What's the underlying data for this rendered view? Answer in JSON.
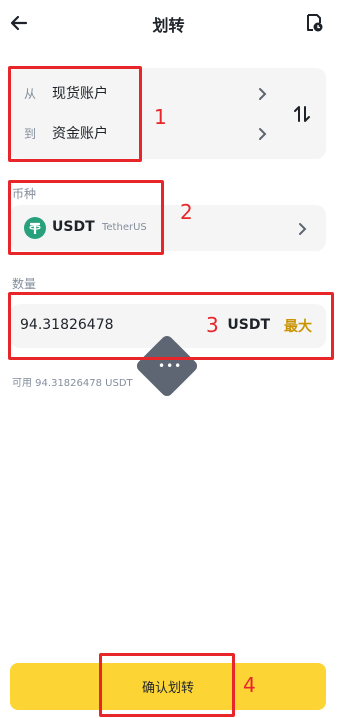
{
  "header": {
    "title": "划转",
    "back_icon": "back-arrow-icon",
    "history_icon": "history-icon"
  },
  "transfer": {
    "from_prefix": "从",
    "from_account": "现货账户",
    "to_prefix": "到",
    "to_account": "资金账户",
    "swap_icon": "swap-vertical-icon"
  },
  "coin": {
    "label": "币种",
    "symbol": "USDT",
    "name": "TetherUS",
    "logo_color": "#26a17b"
  },
  "amount": {
    "label": "数量",
    "value": "94.31826478",
    "unit": "USDT",
    "max_label": "最大",
    "available": "可用 94.31826478 USDT"
  },
  "floating": {
    "dots": "•••"
  },
  "confirm_label": "确认划转",
  "annotations": {
    "n1": "1",
    "n2": "2",
    "n3": "3",
    "n4": "4"
  },
  "colors": {
    "accent_yellow": "#fcd535",
    "max_text": "#c99400",
    "annotation_red": "#e8262a"
  }
}
